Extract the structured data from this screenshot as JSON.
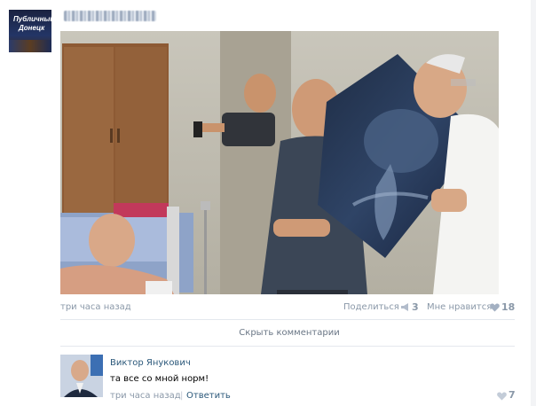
{
  "post": {
    "group": {
      "avatar_text_line1": "Публичный",
      "avatar_text_line2": "Донецк"
    },
    "photo": {
      "description_icon": "photo-collage"
    },
    "time": "три часа назад",
    "share_label": "Поделиться",
    "share_count": "3",
    "like_label": "Мне нравится",
    "like_count": "18"
  },
  "hide_comments_label": "Скрыть комментарии",
  "comment": {
    "author": "Виктор Янукович",
    "text": "та все со мной норм!",
    "time": "три часа назад",
    "separator": "|",
    "reply_label": "Ответить",
    "like_count": "7"
  },
  "colors": {
    "link": "#2b587a",
    "meta": "#8a98a8",
    "divider": "#e4e8ee"
  }
}
